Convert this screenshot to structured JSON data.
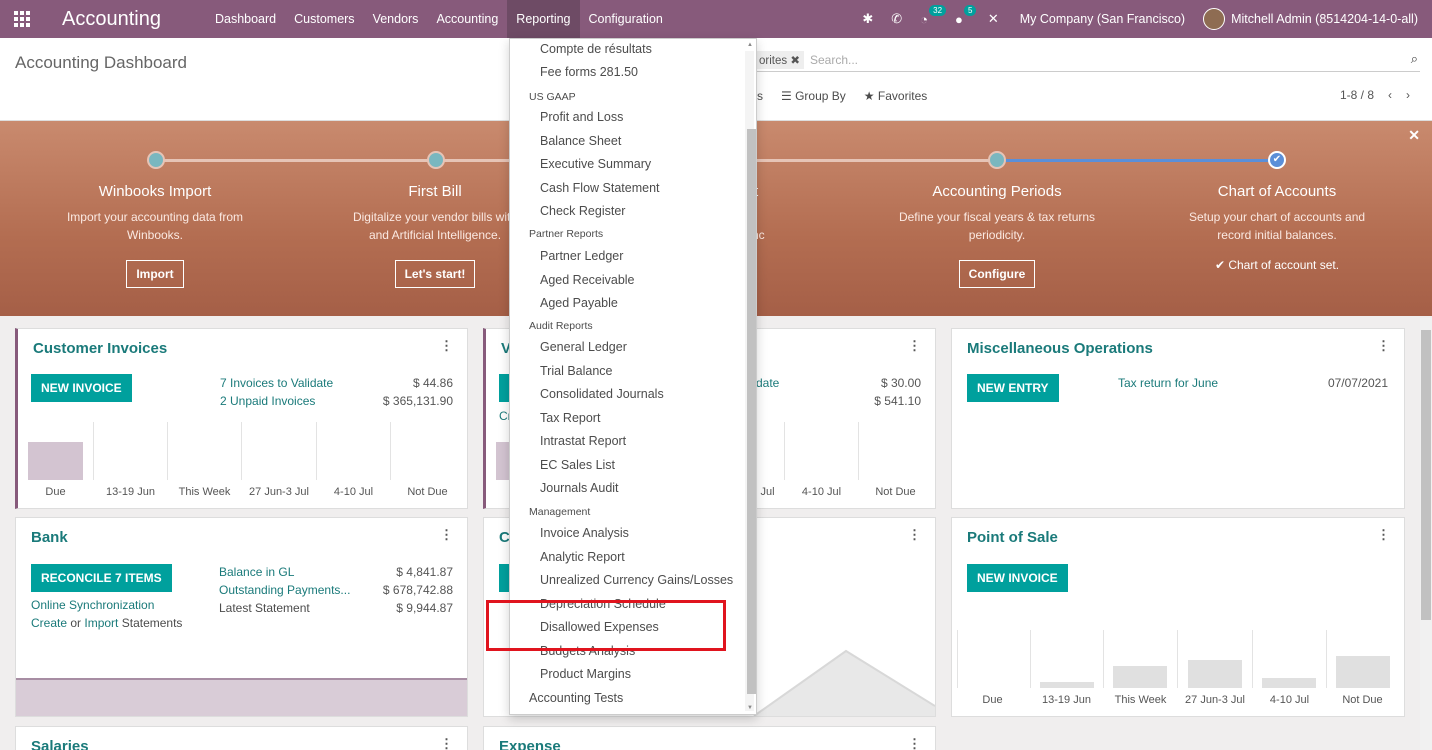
{
  "navbar": {
    "brand": "Accounting",
    "menu": [
      "Dashboard",
      "Customers",
      "Vendors",
      "Accounting",
      "Reporting",
      "Configuration"
    ],
    "active": "Reporting",
    "badges": {
      "activities": "32",
      "messages": "5"
    },
    "company": "My Company (San Francisco)",
    "user": "Mitchell Admin (8514204-14-0-all)"
  },
  "control_panel": {
    "title": "Accounting Dashboard",
    "facet": "orites",
    "search_placeholder": "Search...",
    "filters_tail": "s",
    "group_by": "Group By",
    "favorites": "Favorites",
    "pager": "1-8 / 8"
  },
  "banner": {
    "steps": [
      {
        "title": "Winbooks Import",
        "desc1": "Import your accounting data from",
        "desc2": "Winbooks.",
        "button": "Import"
      },
      {
        "title": "First Bill",
        "desc1": "Digitalize your vendor bills with",
        "desc2": "and Artificial Intelligence.",
        "button": "Let's start!"
      },
      {
        "title": "t",
        "desc1": "t to sync",
        "desc2": "",
        "button": ""
      },
      {
        "title": "Accounting Periods",
        "desc1": "Define your fiscal years & tax returns",
        "desc2": "periodicity.",
        "button": "Configure"
      },
      {
        "title": "Chart of Accounts",
        "desc1": "Setup your chart of accounts and",
        "desc2": "record initial balances.",
        "done": "✔ Chart of account set."
      }
    ]
  },
  "cards": {
    "customer_invoices": {
      "title": "Customer Invoices",
      "button": "NEW INVOICE",
      "link1": "7 Invoices to Validate",
      "amt1": "$ 44.86",
      "link2": "2 Unpaid Invoices",
      "amt2": "$ 365,131.90",
      "labels": [
        "Due",
        "13-19 Jun",
        "This Week",
        "27 Jun-3 Jul",
        "4-10 Jul",
        "Not Due"
      ]
    },
    "vendor_bills": {
      "title": "V",
      "link1": "date",
      "amt1": "$ 30.00",
      "amt2": "$ 541.10",
      "cr": "Cr",
      "labels": [
        "3 Jul",
        "4-10 Jul",
        "Not Due"
      ]
    },
    "misc": {
      "title": "Miscellaneous Operations",
      "button": "NEW ENTRY",
      "link1": "Tax return for June",
      "date1": "07/07/2021"
    },
    "bank": {
      "title": "Bank",
      "button": "RECONCILE 7 ITEMS",
      "online_sync": "Online Synchronization",
      "create": "Create",
      "or": " or ",
      "import": "Import",
      "statements": " Statements",
      "l1": "Balance in GL",
      "a1": "$ 4,841.87",
      "l2": "Outstanding Payments...",
      "a2": "$ 678,742.88",
      "l3": "Latest Statement",
      "a3": "$ 9,944.87"
    },
    "cash": {
      "title": "C"
    },
    "pos": {
      "title": "Point of Sale",
      "button": "NEW INVOICE",
      "labels": [
        "Due",
        "13-19 Jun",
        "This Week",
        "27 Jun-3 Jul",
        "4-10 Jul",
        "Not Due"
      ]
    },
    "salaries": {
      "title": "Salaries"
    },
    "expense": {
      "title": "Expense"
    }
  },
  "dropdown": {
    "items": [
      {
        "kind": "item",
        "label": "Compte de résultats"
      },
      {
        "kind": "item",
        "label": "Fee forms 281.50"
      },
      {
        "kind": "header",
        "label": "US GAAP"
      },
      {
        "kind": "item",
        "label": "Profit and Loss"
      },
      {
        "kind": "item",
        "label": "Balance Sheet"
      },
      {
        "kind": "item",
        "label": "Executive Summary"
      },
      {
        "kind": "item",
        "label": "Cash Flow Statement"
      },
      {
        "kind": "item",
        "label": "Check Register"
      },
      {
        "kind": "header",
        "label": "Partner Reports"
      },
      {
        "kind": "item",
        "label": "Partner Ledger"
      },
      {
        "kind": "item",
        "label": "Aged Receivable"
      },
      {
        "kind": "item",
        "label": "Aged Payable"
      },
      {
        "kind": "header",
        "label": "Audit Reports"
      },
      {
        "kind": "item",
        "label": "General Ledger"
      },
      {
        "kind": "item",
        "label": "Trial Balance"
      },
      {
        "kind": "item",
        "label": "Consolidated Journals"
      },
      {
        "kind": "item",
        "label": "Tax Report"
      },
      {
        "kind": "item",
        "label": "Intrastat Report"
      },
      {
        "kind": "item",
        "label": "EC Sales List"
      },
      {
        "kind": "item",
        "label": "Journals Audit"
      },
      {
        "kind": "header",
        "label": "Management"
      },
      {
        "kind": "item",
        "label": "Invoice Analysis"
      },
      {
        "kind": "item",
        "label": "Analytic Report"
      },
      {
        "kind": "item",
        "label": "Unrealized Currency Gains/Losses"
      },
      {
        "kind": "item",
        "label": "Depreciation Schedule"
      },
      {
        "kind": "item",
        "label": "Disallowed Expenses"
      },
      {
        "kind": "item",
        "label": "Budgets Analysis"
      },
      {
        "kind": "item",
        "label": "Product Margins"
      },
      {
        "kind": "top",
        "label": "Accounting Tests"
      }
    ]
  }
}
